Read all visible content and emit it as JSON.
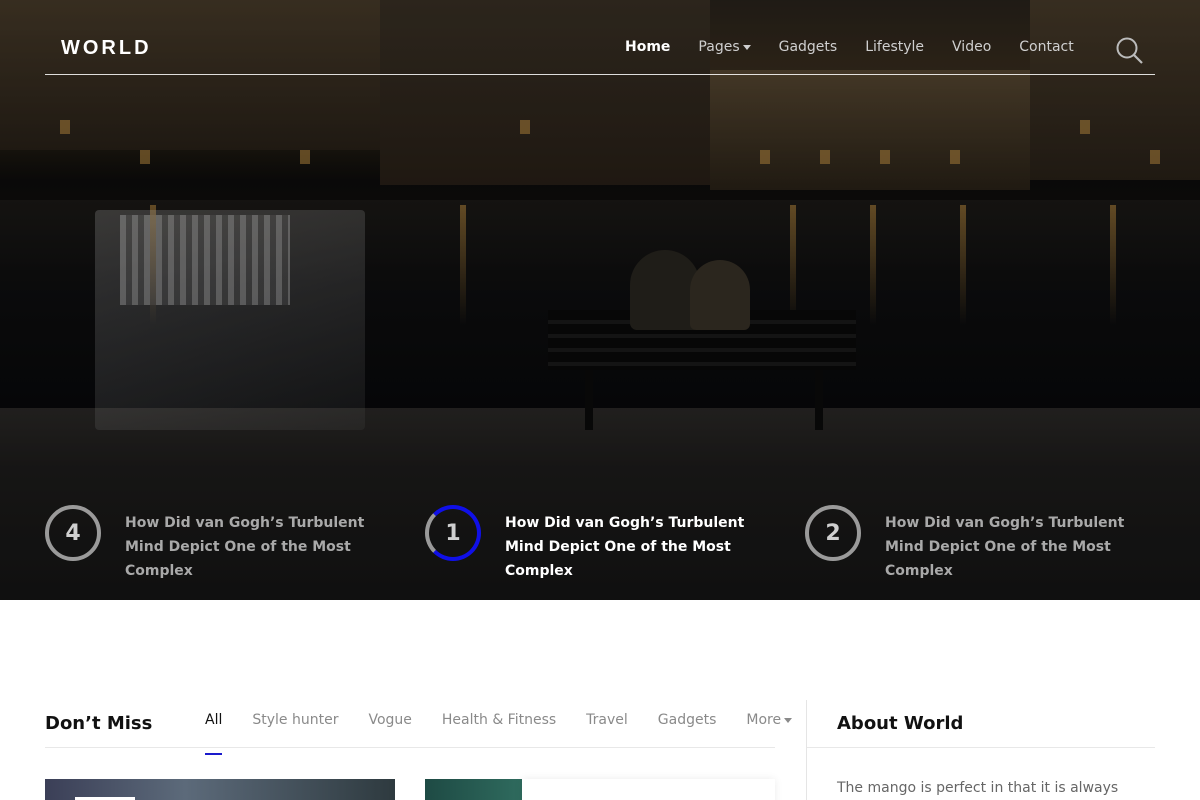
{
  "nav": {
    "logo": "WORLD",
    "items": [
      {
        "label": "Home",
        "active": true,
        "dropdown": false
      },
      {
        "label": "Pages",
        "active": false,
        "dropdown": true
      },
      {
        "label": "Gadgets",
        "active": false,
        "dropdown": false
      },
      {
        "label": "Lifestyle",
        "active": false,
        "dropdown": false
      },
      {
        "label": "Video",
        "active": false,
        "dropdown": false
      },
      {
        "label": "Contact",
        "active": false,
        "dropdown": false
      }
    ],
    "search_icon": "search-icon"
  },
  "hero_slides": [
    {
      "number": "4",
      "title": "How Did van Gogh’s Turbulent Mind Depict One of the Most Complex",
      "active": false
    },
    {
      "number": "1",
      "title": "How Did van Gogh’s Turbulent Mind Depict One of the Most Complex",
      "active": true
    },
    {
      "number": "2",
      "title": "How Did van Gogh’s Turbulent Mind Depict One of the Most Complex",
      "active": false
    }
  ],
  "dont_miss": {
    "title": "Don’t Miss",
    "tabs": [
      {
        "label": "All",
        "active": true
      },
      {
        "label": "Style hunter",
        "active": false
      },
      {
        "label": "Vogue",
        "active": false
      },
      {
        "label": "Health & Fitness",
        "active": false
      },
      {
        "label": "Travel",
        "active": false
      },
      {
        "label": "Gadgets",
        "active": false
      },
      {
        "label": "More",
        "active": false,
        "dropdown": true
      }
    ]
  },
  "about": {
    "title": "About World",
    "text": "The mango is perfect in that it is always"
  },
  "colors": {
    "accent": "#1010e8",
    "tab_underline": "#1a1acc"
  }
}
